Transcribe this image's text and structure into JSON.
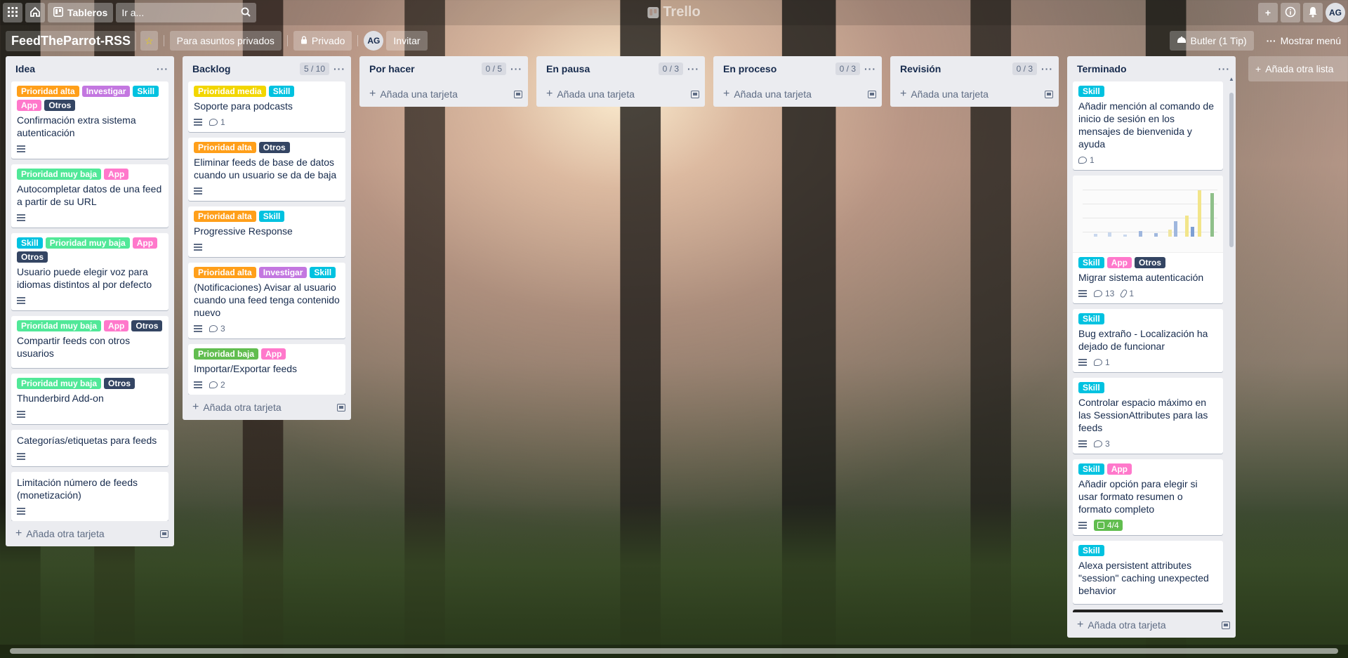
{
  "topbar": {
    "boards_label": "Tableros",
    "search_placeholder": "Ir a...",
    "logo": "Trello",
    "avatar": "AG"
  },
  "board": {
    "name": "FeedTheParrot-RSS",
    "team_label": "Para asuntos privados",
    "visibility_label": "Privado",
    "member_avatar": "AG",
    "invite_label": "Invitar",
    "butler_label": "Butler (1 Tip)",
    "menu_label": "Mostrar menú",
    "add_list_label": "Añada otra lista"
  },
  "label_colors": {
    "Prioridad alta": "#ff9f1a",
    "Prioridad media": "#f2d600",
    "Prioridad baja": "#61bd4f",
    "Prioridad muy baja": "#51e898",
    "Investigar": "#c377e0",
    "Skill": "#00c2e0",
    "App": "#ff78cb",
    "Otros": "#344563"
  },
  "add_card_label": "Añada otra tarjeta",
  "add_card_first_label": "Añada una tarjeta",
  "lists": [
    {
      "title": "Idea",
      "limit": "",
      "cards": [
        {
          "labels": [
            "Prioridad alta",
            "Investigar",
            "Skill",
            "App",
            "Otros"
          ],
          "title": "Confirmación extra sistema autenticación",
          "desc": true
        },
        {
          "labels": [
            "Prioridad muy baja",
            "App"
          ],
          "title": "Autocompletar datos de una feed a partir de su URL",
          "desc": true
        },
        {
          "labels": [
            "Skill",
            "Prioridad muy baja",
            "App",
            "Otros"
          ],
          "title": "Usuario puede elegir voz para idiomas distintos al por defecto",
          "desc": true
        },
        {
          "labels": [
            "Prioridad muy baja",
            "App",
            "Otros"
          ],
          "title": "Compartir feeds con otros usuarios",
          "desc": false
        },
        {
          "labels": [
            "Prioridad muy baja",
            "Otros"
          ],
          "title": "Thunderbird Add-on",
          "desc": true
        },
        {
          "labels": [],
          "title": "Categorías/etiquetas para feeds",
          "desc": true
        },
        {
          "labels": [],
          "title": "Limitación número de feeds (monetización)",
          "desc": true
        }
      ]
    },
    {
      "title": "Backlog",
      "limit": "5 / 10",
      "cards": [
        {
          "labels": [
            "Prioridad media",
            "Skill"
          ],
          "title": "Soporte para podcasts",
          "desc": true,
          "comments": "1"
        },
        {
          "labels": [
            "Prioridad alta",
            "Otros"
          ],
          "title": "Eliminar feeds de base de datos cuando un usuario se da de baja",
          "desc": true
        },
        {
          "labels": [
            "Prioridad alta",
            "Skill"
          ],
          "title": "Progressive Response",
          "desc": true
        },
        {
          "labels": [
            "Prioridad alta",
            "Investigar",
            "Skill"
          ],
          "title": "(Notificaciones) Avisar al usuario cuando una feed tenga contenido nuevo",
          "desc": true,
          "comments": "3"
        },
        {
          "labels": [
            "Prioridad baja",
            "App"
          ],
          "title": "Importar/Exportar feeds",
          "desc": true,
          "comments": "2"
        }
      ]
    },
    {
      "title": "Por hacer",
      "limit": "0 / 5",
      "cards": []
    },
    {
      "title": "En pausa",
      "limit": "0 / 3",
      "cards": []
    },
    {
      "title": "En proceso",
      "limit": "0 / 3",
      "cards": []
    },
    {
      "title": "Revisión",
      "limit": "0 / 3",
      "cards": []
    },
    {
      "title": "Terminado",
      "limit": "",
      "cards": [
        {
          "labels": [
            "Skill"
          ],
          "title": "Añadir mención al comando de inicio de sesión en los mensajes de bienvenida y ayuda",
          "desc": false,
          "comments": "1"
        },
        {
          "cover": "chart",
          "labels": [
            "Skill",
            "App",
            "Otros"
          ],
          "title": "Migrar sistema autenticación",
          "desc": true,
          "comments": "13",
          "attachments": "1"
        },
        {
          "labels": [
            "Skill"
          ],
          "title": "Bug extraño - Localización ha dejado de funcionar",
          "desc": true,
          "comments": "1"
        },
        {
          "labels": [
            "Skill"
          ],
          "title": "Controlar espacio máximo en las SessionAttributes para las feeds",
          "desc": true,
          "comments": "3"
        },
        {
          "labels": [
            "Skill",
            "App"
          ],
          "title": "Añadir opción para elegir si usar formato resumen o formato completo",
          "desc": true,
          "checklist": "4/4"
        },
        {
          "labels": [
            "Skill"
          ],
          "title": "Alexa persistent attributes \"session\" caching unexpected behavior",
          "desc": false
        },
        {
          "cover": "dark",
          "labels": [],
          "title": "",
          "desc": false
        }
      ]
    }
  ]
}
